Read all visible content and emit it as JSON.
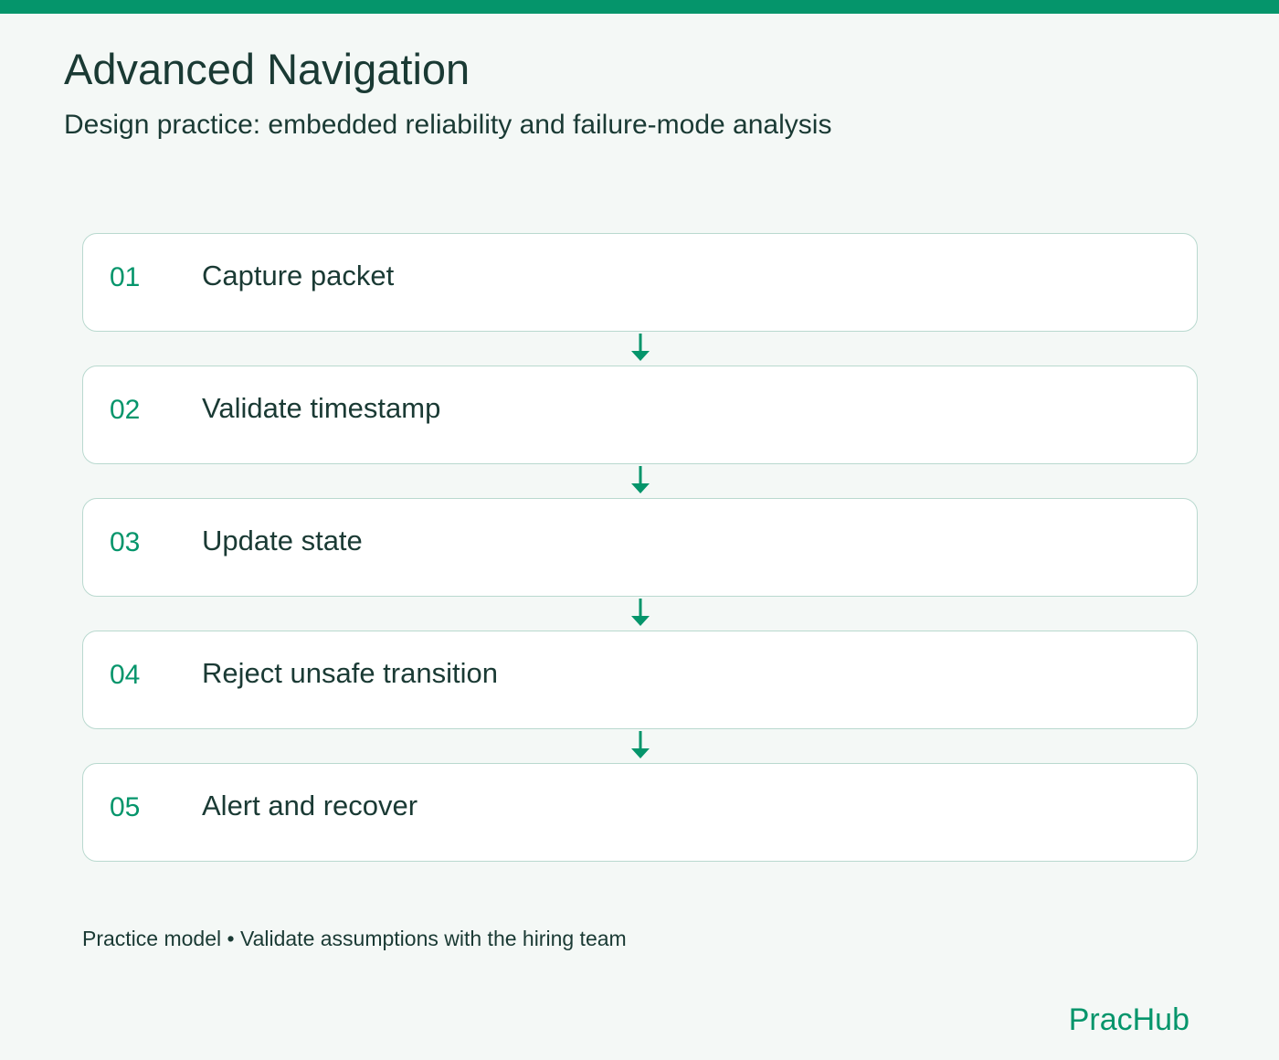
{
  "header": {
    "title": "Advanced Navigation",
    "subtitle": "Design practice: embedded reliability and failure-mode analysis"
  },
  "steps": [
    {
      "number": "01",
      "label": "Capture packet"
    },
    {
      "number": "02",
      "label": "Validate timestamp"
    },
    {
      "number": "03",
      "label": "Update state"
    },
    {
      "number": "04",
      "label": "Reject unsafe transition"
    },
    {
      "number": "05",
      "label": "Alert and recover"
    }
  ],
  "footer": {
    "note": "Practice model • Validate assumptions with the hiring team",
    "brand": "PracHub"
  },
  "colors": {
    "accent": "#05956b",
    "text": "#1a3a34",
    "background": "#f4f8f6",
    "card_border": "#b9d9cf"
  }
}
